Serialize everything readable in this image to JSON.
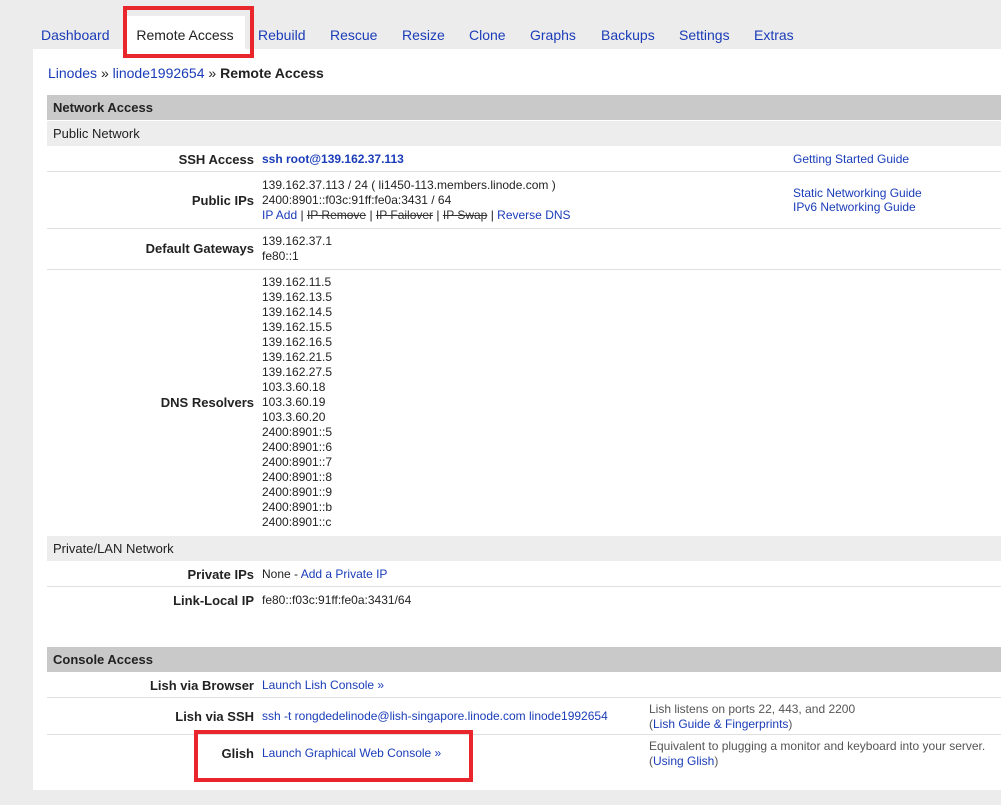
{
  "tabs": [
    {
      "label": "Dashboard"
    },
    {
      "label": "Remote Access"
    },
    {
      "label": "Rebuild"
    },
    {
      "label": "Rescue"
    },
    {
      "label": "Resize"
    },
    {
      "label": "Clone"
    },
    {
      "label": "Graphs"
    },
    {
      "label": "Backups"
    },
    {
      "label": "Settings"
    },
    {
      "label": "Extras"
    }
  ],
  "breadcrumb": {
    "root": "Linodes",
    "sep": "»",
    "node": "linode1992654",
    "current": "Remote Access"
  },
  "network": {
    "title": "Network Access",
    "public_title": "Public Network",
    "ssh": {
      "label": "SSH Access",
      "value": "ssh root@139.162.37.113",
      "guide": "Getting Started Guide"
    },
    "public_ips": {
      "label": "Public IPs",
      "ipv4": "139.162.37.113 / 24 ( li1450-113.members.linode.com )",
      "ipv6": "2400:8901::f03c:91ff:fe0a:3431 / 64",
      "ip_add": "IP Add",
      "ip_remove": "IP Remove",
      "ip_failover": "IP Failover",
      "ip_swap": "IP Swap",
      "reverse_dns": "Reverse DNS",
      "sep": "|",
      "guide_static": "Static Networking Guide",
      "guide_ipv6": "IPv6 Networking Guide"
    },
    "gateways": {
      "label": "Default Gateways",
      "values": [
        "139.162.37.1",
        "fe80::1"
      ]
    },
    "dns": {
      "label": "DNS Resolvers",
      "values": [
        "139.162.11.5",
        "139.162.13.5",
        "139.162.14.5",
        "139.162.15.5",
        "139.162.16.5",
        "139.162.21.5",
        "139.162.27.5",
        "103.3.60.18",
        "103.3.60.19",
        "103.3.60.20",
        "2400:8901::5",
        "2400:8901::6",
        "2400:8901::7",
        "2400:8901::8",
        "2400:8901::9",
        "2400:8901::b",
        "2400:8901::c"
      ]
    },
    "private_title": "Private/LAN Network",
    "private_ips": {
      "label": "Private IPs",
      "value": "None -",
      "add": "Add a Private IP"
    },
    "link_local": {
      "label": "Link-Local IP",
      "value": "fe80::f03c:91ff:fe0a:3431/64"
    }
  },
  "console": {
    "title": "Console Access",
    "lish_browser": {
      "label": "Lish via Browser",
      "link": "Launch Lish Console »"
    },
    "lish_ssh": {
      "label": "Lish via SSH",
      "link": "ssh -t rongdedelinode@lish-singapore.linode.com linode1992654",
      "note": "Lish listens on ports 22, 443, and 2200",
      "note_open": "(",
      "note_link": "Lish Guide & Fingerprints",
      "note_close": ")"
    },
    "glish": {
      "label": "Glish",
      "link": "Launch Graphical Web Console »",
      "note": "Equivalent to plugging a monitor and keyboard into your server.",
      "note_open": "(",
      "note_link": "Using Glish",
      "note_close": ")"
    }
  },
  "colors": {
    "link": "#1a3cb8",
    "highlight": "#e8262b",
    "section_header": "#c9c9c9",
    "subsection_header": "#ededed",
    "page_bg": "#ececec"
  }
}
